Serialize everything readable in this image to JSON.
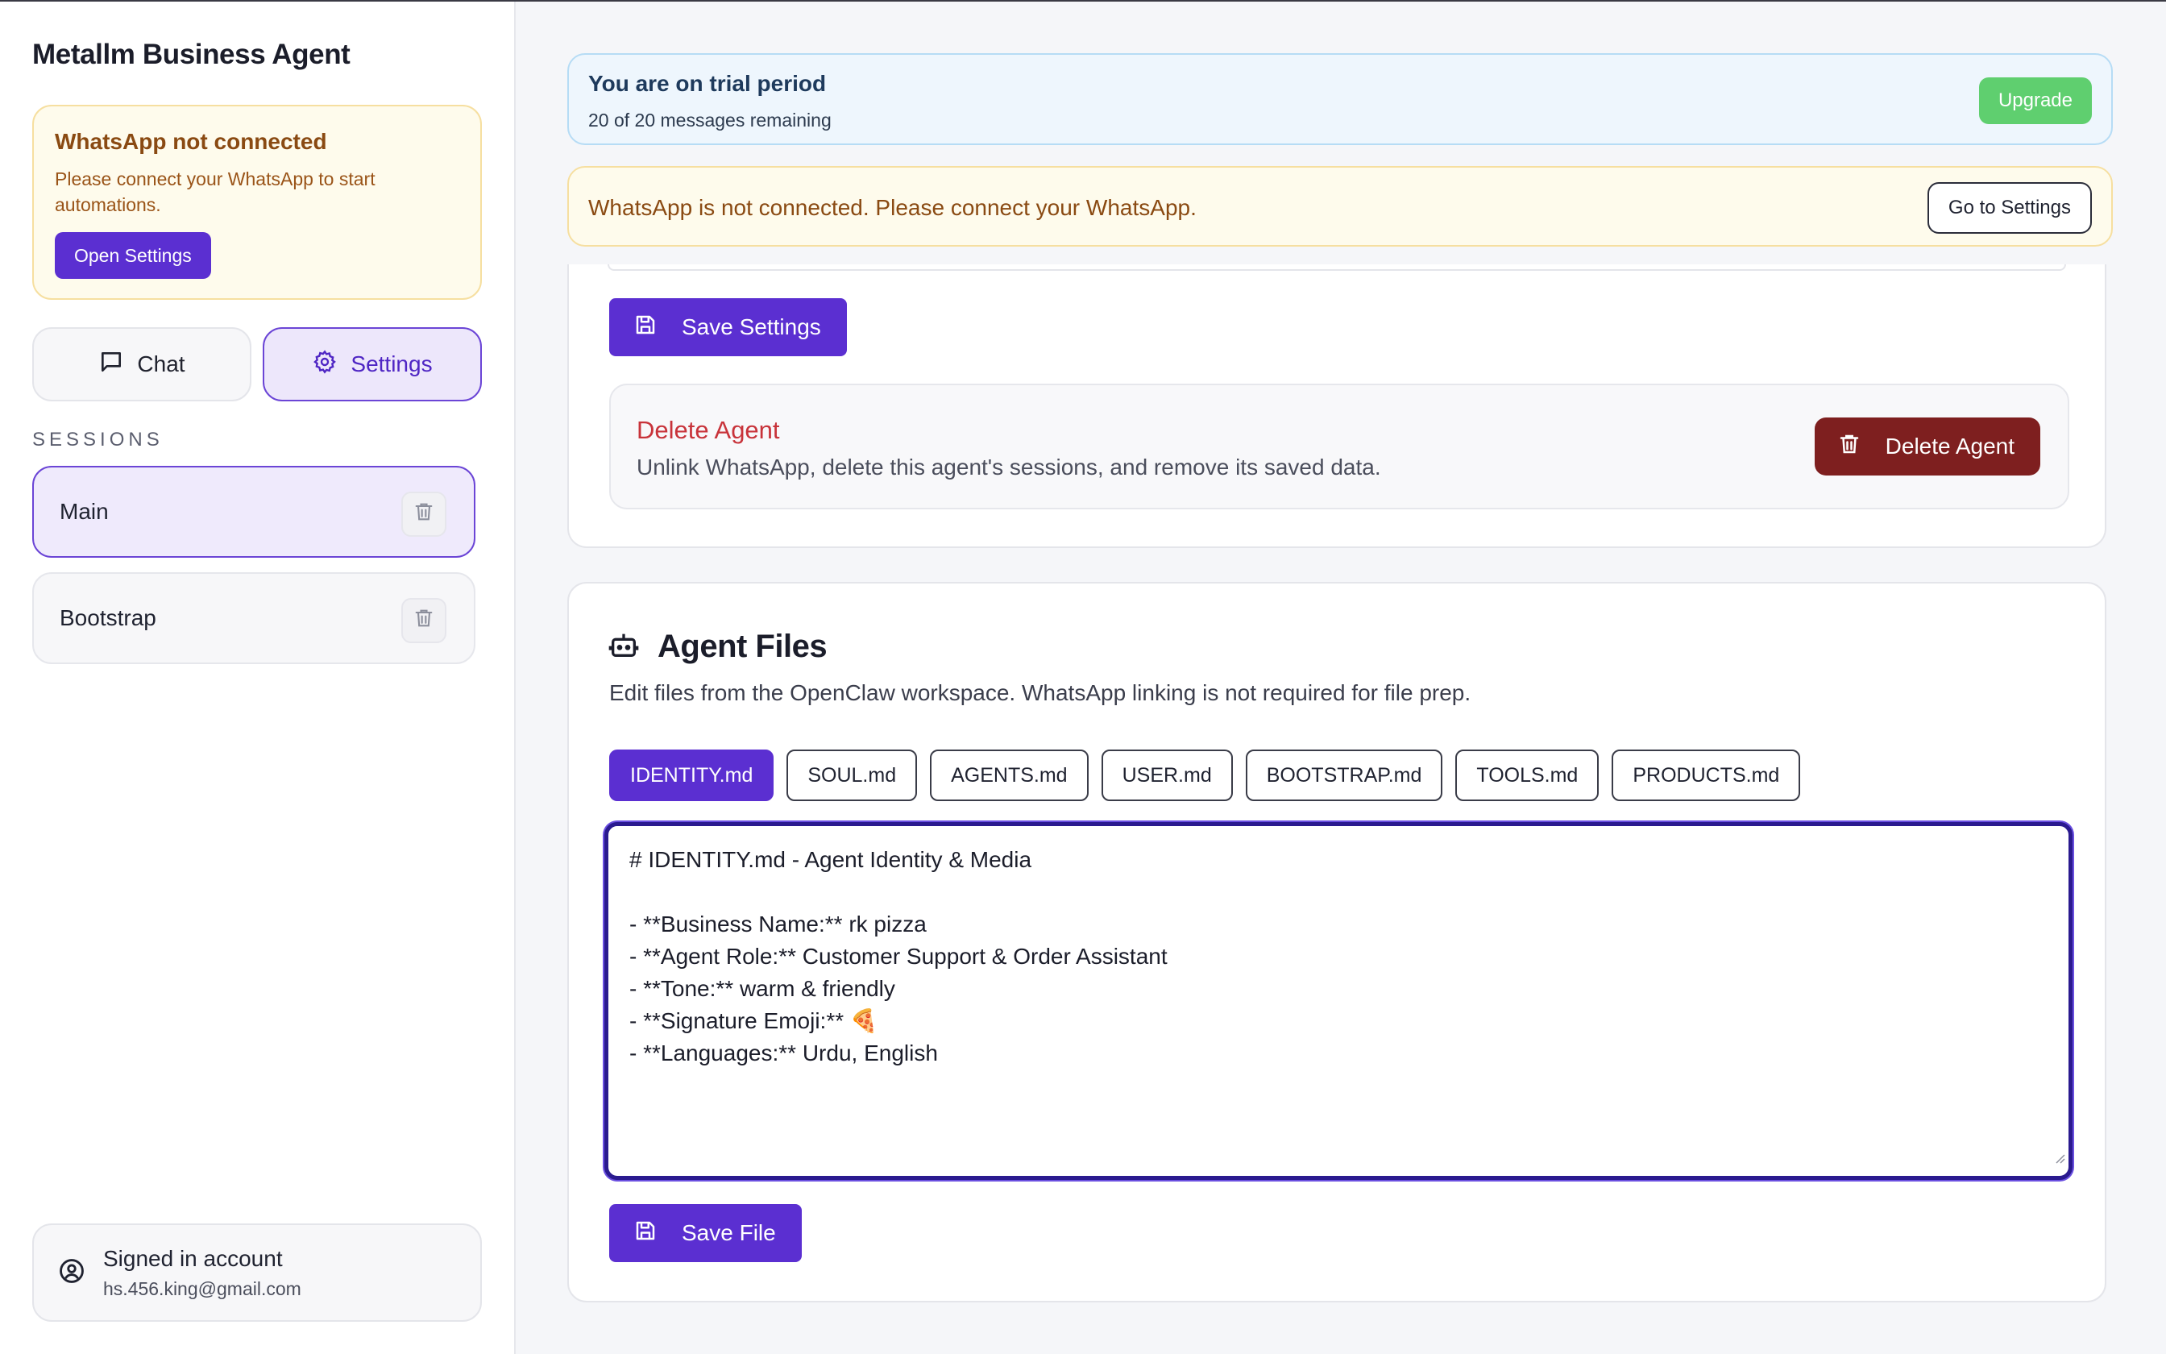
{
  "app": {
    "title": "Metallm Business Agent"
  },
  "sidebar": {
    "alert": {
      "title": "WhatsApp not connected",
      "text": "Please connect your WhatsApp to start automations.",
      "button": "Open Settings"
    },
    "nav": {
      "chat": "Chat",
      "settings": "Settings",
      "active": "Settings"
    },
    "sessions_label": "SESSIONS",
    "sessions": [
      {
        "name": "Main",
        "selected": true
      },
      {
        "name": "Bootstrap",
        "selected": false
      }
    ],
    "account": {
      "label": "Signed in account",
      "email": "hs.456.king@gmail.com"
    }
  },
  "trial": {
    "title": "You are on trial period",
    "subtitle": "20 of 20 messages remaining",
    "button": "Upgrade"
  },
  "wa_banner": {
    "text": "WhatsApp is not connected. Please connect your WhatsApp.",
    "button": "Go to Settings"
  },
  "settings": {
    "save_button": "Save Settings",
    "danger": {
      "title": "Delete Agent",
      "text": "Unlink WhatsApp, delete this agent's sessions, and remove its saved data.",
      "button": "Delete Agent"
    }
  },
  "files": {
    "title": "Agent Files",
    "description": "Edit files from the OpenClaw workspace. WhatsApp linking is not required for file prep.",
    "tabs": [
      "IDENTITY.md",
      "SOUL.md",
      "AGENTS.md",
      "USER.md",
      "BOOTSTRAP.md",
      "TOOLS.md",
      "PRODUCTS.md"
    ],
    "active_tab": "IDENTITY.md",
    "editor_lines": [
      "# IDENTITY.md - Agent Identity & Media",
      "",
      "- **Business Name:** rk pizza",
      "- **Agent Role:** Customer Support & Order Assistant",
      "- **Tone:** warm & friendly",
      "- **Signature Emoji:** 🍕",
      "- **Languages:** Urdu, English"
    ],
    "save_button": "Save File"
  },
  "colors": {
    "accent": "#5b2fd1",
    "danger": "#7e1f1f",
    "upgrade": "#5fcf6f",
    "warning_bg": "#fefbec",
    "info_bg": "#eef6fd"
  },
  "icons": [
    "chat-bubble-icon",
    "gear-icon",
    "trash-icon",
    "save-icon",
    "robot-icon",
    "user-circle-icon"
  ]
}
